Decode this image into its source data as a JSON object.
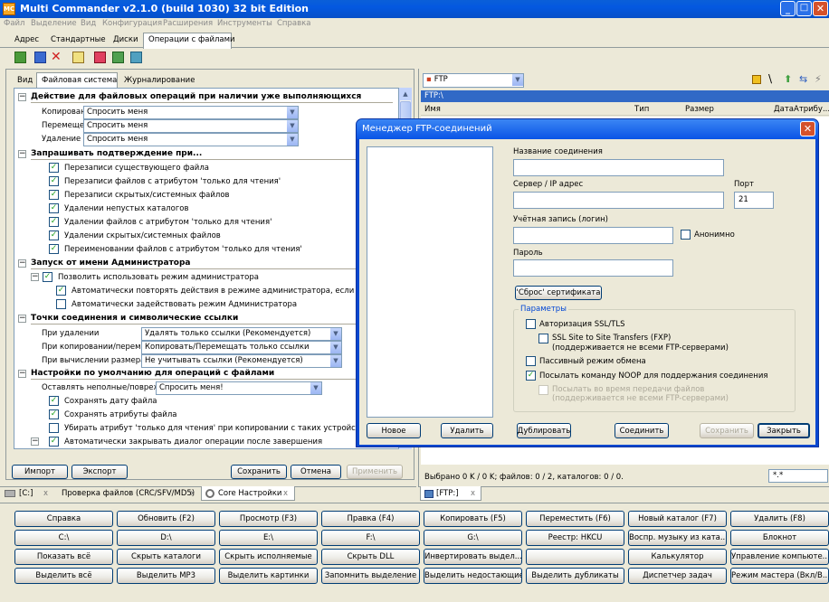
{
  "window": {
    "title": "Multi Commander v2.1.0 (build 1030) 32 bit Edition"
  },
  "menu": [
    "Файл",
    "Выделение",
    "Вид",
    "Конфигурация",
    "Расширения",
    "Инструменты",
    "Справка"
  ],
  "ribbon_tabs": [
    "Адрес",
    "Стандартные",
    "Диски",
    "Операции с файлами"
  ],
  "left_panel": {
    "tabs": [
      "Вид",
      "Файловая система",
      "Журналирование"
    ],
    "sections": {
      "s1": "Действие для файловых операций при наличии уже выполняющихся",
      "s2": "Запрашивать подтверждение при...",
      "s3": "Запуск от имени Администратора",
      "s4": "Точки соединения и символические ссылки",
      "s5": "Настройки по умолчанию для операций с файлами"
    },
    "s1_rows": [
      {
        "label": "Копирование",
        "value": "Спросить меня"
      },
      {
        "label": "Перемещение",
        "value": "Спросить меня"
      },
      {
        "label": "Удаление",
        "value": "Спросить меня"
      }
    ],
    "s2_items": [
      "Перезаписи существующего файла",
      "Перезаписи файлов с атрибутом 'только для чтения'",
      "Перезаписи скрытых/системных файлов",
      "Удалении непустых каталогов",
      "Удалении файлов с атрибутом 'только для чтения'",
      "Удалении скрытых/системных файлов",
      "Переименовании файлов с атрибутом 'только для чтения'"
    ],
    "s3_parent": "Позволить использовать режим администратора",
    "s3_items": [
      "Автоматически повторять действия в режиме администратора, если он исполь",
      "Автоматически задействовать режим Администратора"
    ],
    "s4_rows": [
      {
        "label": "При удалении",
        "value": "Удалять только ссылки (Рекомендуется)"
      },
      {
        "label": "При копировании/перемещении",
        "value": "Копировать/Перемещать только ссылки"
      },
      {
        "label": "При вычислении размера",
        "value": "Не учитывать ссылки (Рекомендуется)"
      }
    ],
    "s5_row": {
      "label": "Оставлять неполные/поврежденные",
      "value": "Спросить меня!"
    },
    "s5_items": [
      "Сохранять дату файла",
      "Сохранять атрибуты файла",
      "Убирать атрибут 'только для чтения' при копировании с таких устройств как CD/D",
      "Автоматически закрывать диалог операции после завершения"
    ],
    "buttons": {
      "import": "Импорт",
      "export": "Экспорт",
      "save": "Сохранить",
      "cancel": "Отмена",
      "apply": "Применить"
    },
    "bottom_tabs": [
      "[C:]",
      "Проверка файлов (CRC/SFV/MD5)",
      "Core Настройки"
    ]
  },
  "right_panel": {
    "drive": "FTP",
    "path": "FTP:\\",
    "columns": [
      "Имя",
      "Тип",
      "Размер",
      "Дата",
      "Атрибу..."
    ],
    "status": "Выбрано 0 K / 0 K; файлов: 0 / 2, каталогов: 0 / 0.",
    "filter": "*.*",
    "tab": "[FTP:]"
  },
  "dialog": {
    "title": "Менеджер FTP-соединений",
    "conn_name_label": "Название соединения",
    "server_label": "Сервер / IP адрес",
    "port_label": "Порт",
    "port_value": "21",
    "login_label": "Учётная запись (логин)",
    "anon_label": "Анонимно",
    "password_label": "Пароль",
    "reset_cert": "'Сброс' сертификата",
    "params_label": "Параметры",
    "ssl": "Авторизация SSL/TLS",
    "fxp1": "SSL Site to Site Transfers (FXP)",
    "fxp2": "(поддерживается не всеми FTP-серверами)",
    "passive": "Пассивный режим обмена",
    "noop": "Посылать команду NOOP для поддержания соединения",
    "noop_dl1": "Посылать во время передачи файлов",
    "noop_dl2": "(поддерживается не всеми FTP-серверами)",
    "buttons": {
      "new": "Новое",
      "delete": "Удалить",
      "dup": "Дублировать",
      "connect": "Соединить",
      "save": "Сохранить",
      "close": "Закрыть"
    }
  },
  "fkeys": [
    [
      "Справка",
      "Обновить (F2)",
      "Просмотр (F3)",
      "Правка (F4)",
      "Копировать (F5)",
      "Переместить (F6)",
      "Новый каталог (F7)",
      "Удалить (F8)"
    ],
    [
      "C:\\",
      "D:\\",
      "E:\\",
      "F:\\",
      "G:\\",
      "Реестр: HKCU",
      "Воспр. музыку из ката...",
      "Блокнот"
    ],
    [
      "Показать всё",
      "Скрыть каталоги",
      "Скрыть исполняемые",
      "Скрыть DLL",
      "Инвертировать выдел...",
      "",
      "Калькулятор",
      "Управление компьюте..."
    ],
    [
      "Выделить всё",
      "Выделить MP3",
      "Выделить картинки",
      "Запомнить выделение",
      "Выделить недостающие",
      "Выделить дубликаты",
      "Диспетчер задач",
      "Режим мастера (Вкл/В..."
    ]
  ]
}
